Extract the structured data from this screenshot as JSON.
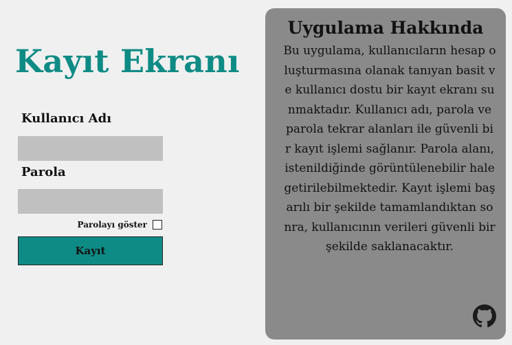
{
  "form": {
    "title": "Kayıt Ekranı",
    "username_label": "Kullanıcı Adı",
    "username_value": "",
    "password_label": "Parola",
    "password_value": "",
    "show_password_label": "Parolayı göster",
    "show_password_checked": false,
    "submit_label": "Kayıt"
  },
  "about": {
    "title": "Uygulama Hakkında",
    "body": "Bu uygulama, kullanıcıların hesap oluşturmasına olanak tanıyan basit ve kullanıcı dostu bir kayıt ekranı sunmaktadır. Kullanıcı adı, parola ve parola tekrar alanları ile güvenli bir kayıt işlemi sağlanır. Parola alanı, istenildiğinde görüntülenebilir hale getirilebilmektedir. Kayıt işlemi başarılı bir şekilde tamamlandıktan sonra, kullanıcının verileri güvenli bir şekilde saklanacaktır.",
    "link_icon": "github-icon"
  },
  "colors": {
    "accent": "#0f8b85",
    "panel": "#8a8a8a",
    "field": "#c0c0c0",
    "background": "#f0f0f0"
  }
}
